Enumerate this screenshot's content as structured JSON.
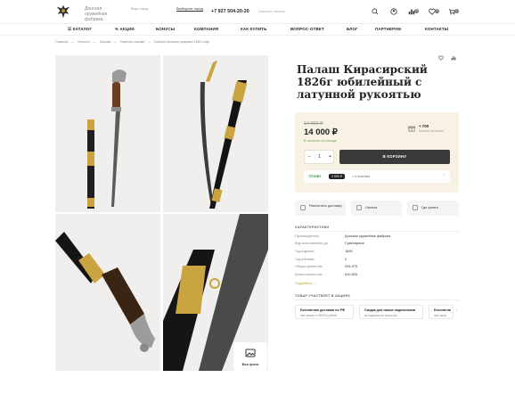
{
  "header": {
    "brand": "Донская оружейная фабрика",
    "city_label": "Ваш город",
    "city_value": "Выберите город",
    "phone": "+7 927 504-20-20",
    "callback": "Заказать звонок",
    "badges": {
      "compare": "0",
      "favorites": "0",
      "cart": "0"
    }
  },
  "nav": [
    "КАТАЛОГ",
    "АКЦИИ",
    "БОНУСЫ",
    "КОМПАНИЯ",
    "КАК КУПИТЬ",
    "ВОПРОС-ОТВЕТ",
    "БЛОГ",
    "ПАРТНЕРАМ",
    "КОНТАКТЫ"
  ],
  "breadcrumbs": [
    "Главная",
    "Каталог",
    "Шашки",
    "Казачьи шашки",
    "Шашка Казачья рядовая 1881 года"
  ],
  "gallery": {
    "all_photo": "Все фото"
  },
  "product": {
    "title": "Палаш Кирасирский 1826г юбилейный с латунной рукоятью",
    "old_price": "14 000 ₽",
    "price": "14 000 ₽",
    "stock": "В наличии на складе",
    "bonus": "+ 700",
    "bonus_sub": "бонусов на баланс",
    "qty": "1",
    "cart_button": "В КОРЗИНУ",
    "split": {
      "logo": "Сплит",
      "amount": "3 500 ₽",
      "text": "× 4 платежа"
    }
  },
  "options": [
    "Рассчитать доставку",
    "Оплата",
    "Где купить"
  ],
  "specs": {
    "title": "ХАРАКТЕРИСТИКИ",
    "rows": [
      {
        "k": "Производитель",
        "v": "Донская оружейная фабрика"
      },
      {
        "k": "Вид изготовления дл.",
        "v": "Сувенирные"
      },
      {
        "k": "Год изделия",
        "v": "1826"
      },
      {
        "k": "Год реплики",
        "v": "2"
      },
      {
        "k": "Общая длина мм",
        "v": "925-975"
      },
      {
        "k": "Длина клинка мм",
        "v": "810-825"
      }
    ],
    "more": "Подробнее"
  },
  "promos": {
    "title": "ТОВАР УЧАСТВУЕТ В АКЦИЯХ",
    "items": [
      {
        "t": "Бесплатная доставка по РФ",
        "s": "при заказе от 50000 рублей"
      },
      {
        "t": "Скидка для наших подписчиков",
        "s": "за подписку на рассылку"
      },
      {
        "t": "Бесплатна",
        "s": "при заказ"
      }
    ]
  },
  "colors": {
    "accent": "#c79a2e",
    "price_bg": "#f8f2e5",
    "button": "#3a3a3a"
  }
}
